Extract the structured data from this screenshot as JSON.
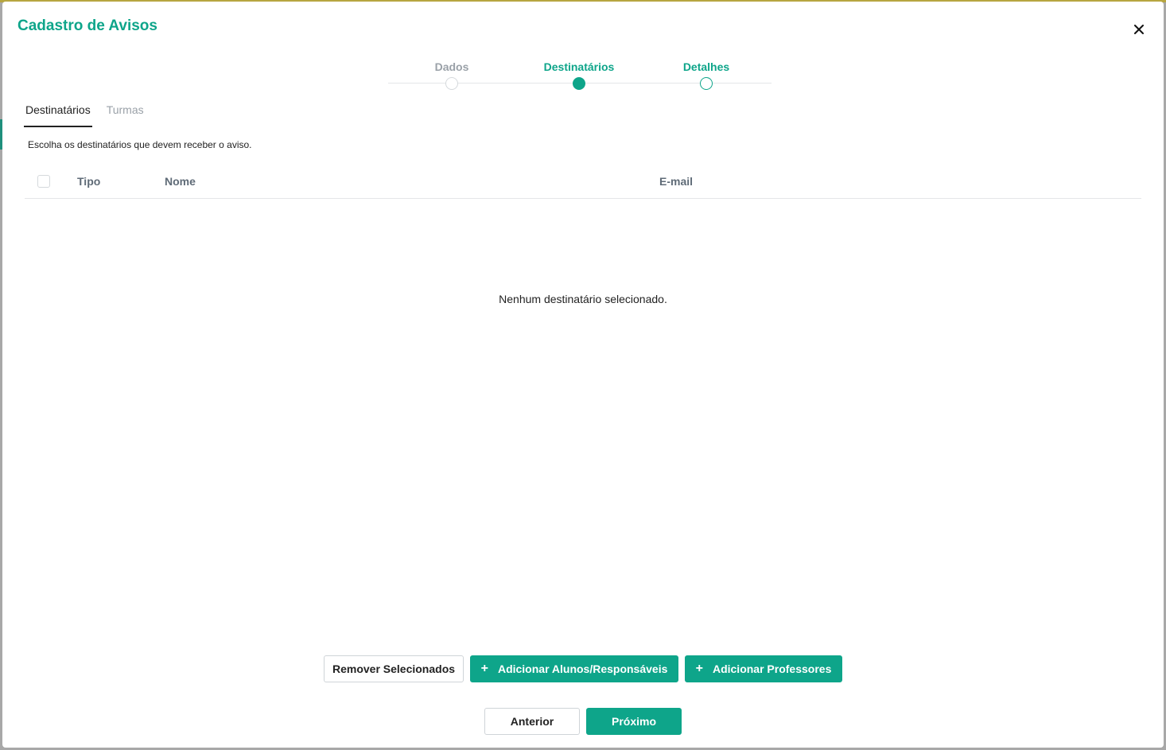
{
  "modal": {
    "title": "Cadastro de Avisos",
    "close_label": "×"
  },
  "stepper": {
    "steps": [
      {
        "label": "Dados",
        "state": "done"
      },
      {
        "label": "Destinatários",
        "state": "active"
      },
      {
        "label": "Detalhes",
        "state": "next"
      }
    ]
  },
  "tabs": [
    {
      "label": "Destinatários",
      "active": true
    },
    {
      "label": "Turmas",
      "active": false
    }
  ],
  "hint": "Escolha os destinatários que devem receber o aviso.",
  "table": {
    "columns": [
      "Tipo",
      "Nome",
      "E-mail"
    ],
    "empty_message": "Nenhum destinatário selecionado."
  },
  "actions": {
    "remove_selected": "Remover Selecionados",
    "add_students": "Adicionar Alunos/Responsáveis",
    "add_teachers": "Adicionar Professores",
    "plus_glyph": "+"
  },
  "footer": {
    "previous": "Anterior",
    "next": "Próximo"
  },
  "colors": {
    "accent": "#0ea58a",
    "top_accent": "#b7a640",
    "muted": "#9aa1a8"
  }
}
